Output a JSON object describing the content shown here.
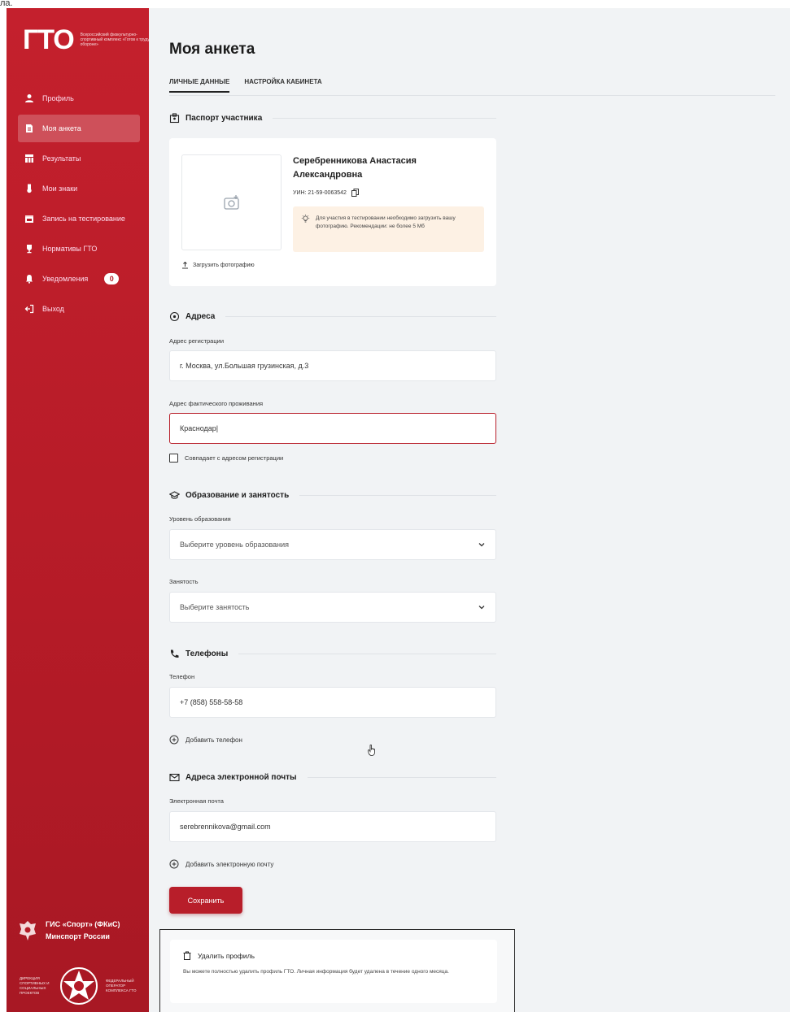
{
  "caption": "ла.",
  "sidebar": {
    "logo": "ГТО",
    "logo_sub": "Всероссийский физкультурно-спортивный комплекс «Готов к труду и обороне»",
    "items": [
      {
        "label": "Профиль",
        "icon": "user-icon",
        "active": false
      },
      {
        "label": "Моя анкета",
        "icon": "document-icon",
        "active": true
      },
      {
        "label": "Результаты",
        "icon": "table-icon",
        "active": false
      },
      {
        "label": "Мои знаки",
        "icon": "medal-icon",
        "active": false
      },
      {
        "label": "Запись на тестирование",
        "icon": "calendar-icon",
        "active": false
      },
      {
        "label": "Нормативы ГТО",
        "icon": "trophy-icon",
        "active": false
      },
      {
        "label": "Уведомления",
        "icon": "bell-icon",
        "active": false,
        "badge": "0"
      },
      {
        "label": "Выход",
        "icon": "logout-icon",
        "active": false
      }
    ],
    "org_line1": "ГИС «Спорт» (ФКиС)",
    "org_line2": "Минспорт России",
    "partner_left": "ДИРЕКЦИЯ СПОРТИВНЫХ И СОЦИАЛЬНЫХ ПРОЕКТОВ",
    "partner_right": "ФЕДЕРАЛЬНЫЙ ОПЕРАТОР КОМПЛЕКСА ГТО"
  },
  "main": {
    "title": "Моя анкета",
    "tabs": [
      {
        "label": "ЛИЧНЫЕ ДАННЫЕ",
        "active": true
      },
      {
        "label": "НАСТРОЙКА КАБИНЕТА",
        "active": false
      }
    ],
    "passport": {
      "heading": "Паспорт участника",
      "name": "Серебренникова Анастасия Александровна",
      "uin": "УИН: 21-59-0063542",
      "upload_label": "Загрузить фотографию",
      "notice": "Для участия в тестировании необходимо загрузить вашу фотографию. Рекомендации: не более 5 Мб"
    },
    "address": {
      "heading": "Адреса",
      "reg_label": "Адрес регистрации",
      "reg_value": "г. Москва, ул.Большая грузинская, д.3",
      "actual_label": "Адрес фактического проживания",
      "actual_value": "Краснодар|",
      "same_label": "Совпадает с адресом регистрации"
    },
    "education": {
      "heading": "Образование и занятость",
      "level_label": "Уровень образования",
      "level_placeholder": "Выберите уровень образования",
      "employment_label": "Занятость",
      "employment_placeholder": "Выберите занятость"
    },
    "phones": {
      "heading": "Телефоны",
      "label": "Телефон",
      "value": "+7 (858) 558-58-58",
      "add_label": "Добавить телефон"
    },
    "emails": {
      "heading": "Адреса электронной почты",
      "label": "Электронная почта",
      "value": "serebrennikova@gmail.com",
      "add_label": "Добавить электронную почту"
    },
    "save_label": "Сохранить",
    "delete": {
      "title": "Удалить профиль",
      "description": "Вы можете полностью удалить профиль ГТО. Личная информация будет удалена в течение одного месяца."
    }
  },
  "colors": {
    "accent": "#b81e2a",
    "sidebar": "#c4202d",
    "notice_bg": "#fdf1e4",
    "page_bg": "#f1f3f5"
  }
}
